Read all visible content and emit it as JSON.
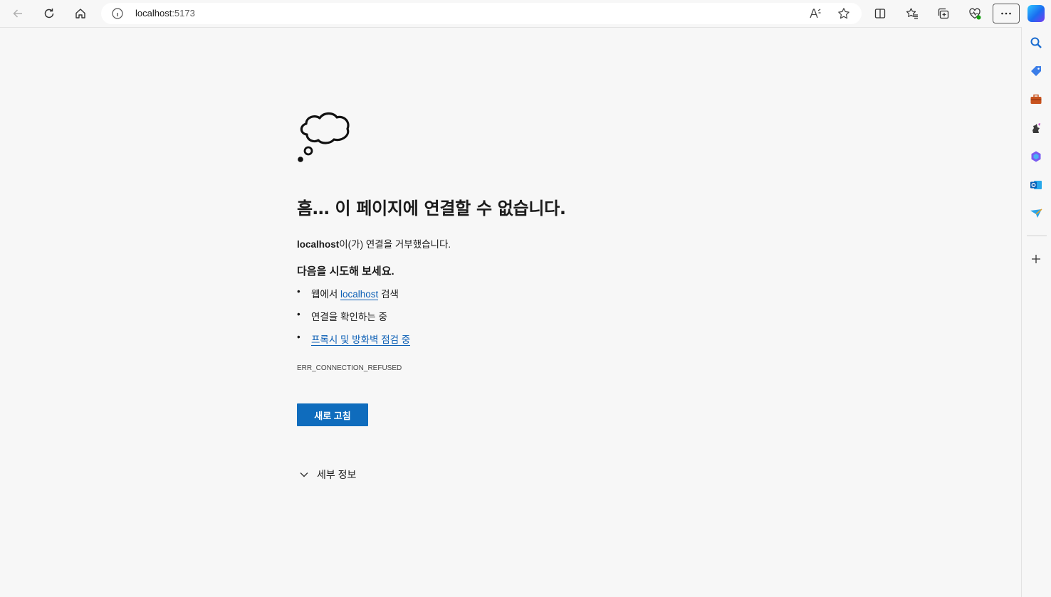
{
  "browser": {
    "url_host": "localhost",
    "url_port": ":5173",
    "buttons": [
      "back",
      "refresh",
      "home",
      "read-aloud",
      "favorite",
      "split-screen",
      "favorites",
      "collections",
      "browser-essentials",
      "settings-and-more",
      "copilot"
    ]
  },
  "sidebar": {
    "items": [
      "search-icon",
      "shopping-icon",
      "tools-icon",
      "games-icon",
      "microsoft-365-icon",
      "outlook-icon",
      "drop-icon",
      "add-icon"
    ]
  },
  "error_page": {
    "title": "흠… 이 페이지에 연결할 수 없습니다.",
    "host": "localhost",
    "desc_suffix": "이(가) 연결을 거부했습니다.",
    "try_heading": "다음을 시도해 보세요.",
    "bullet": "•",
    "suggestion1_prefix": "웹에서 ",
    "suggestion1_link": "localhost",
    "suggestion1_suffix": " 검색",
    "suggestion2": "연결을 확인하는 중",
    "suggestion3_link": "프록시 및 방화벽 점검 중",
    "error_code": "ERR_CONNECTION_REFUSED",
    "reload_label": "새로 고침",
    "details_label": "세부 정보"
  }
}
